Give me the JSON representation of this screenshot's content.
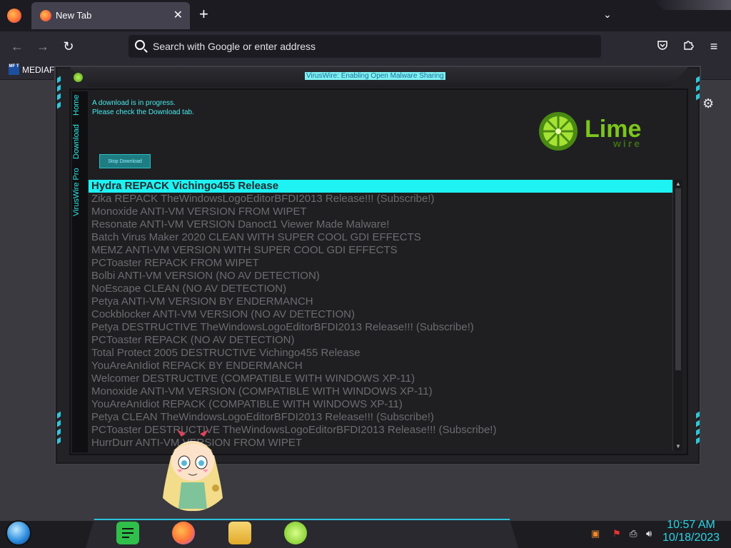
{
  "browser": {
    "tab_title": "New Tab",
    "tab_close": "✕",
    "new_tab": "+",
    "list_tabs": "⌄",
    "url_placeholder": "Search with Google or enter address",
    "bookmark": {
      "label": "MEDIAFI",
      "icon_text": "MF T"
    }
  },
  "app": {
    "title": "VirusWire: Enabling Open Malware Sharing",
    "side_tabs": [
      "Home",
      "Download",
      "VirusWire Pro"
    ],
    "message_line1": "A download is in progress.",
    "message_line2": "Please check the Download tab.",
    "action_button": "Stop Download",
    "logo_text_top": "Lime",
    "logo_text_bottom": "wire",
    "selected_index": 0,
    "items": [
      "Hydra REPACK Vichingo455 Release",
      "Zika REPACK TheWindowsLogoEditorBFDI2013 Release!!! (Subscribe!)",
      "Monoxide ANTI-VM VERSION FROM WIPET",
      "Resonate ANTI-VM VERSION Danoct1 Viewer Made Malware!",
      "Batch Virus Maker 2020 CLEAN WITH SUPER COOL GDI EFFECTS",
      "MEMZ ANTI-VM VERSION WITH SUPER COOL GDI EFFECTS",
      "PCToaster REPACK FROM WIPET",
      "Bolbi ANTI-VM VERSION (NO AV DETECTION)",
      "NoEscape CLEAN (NO AV DETECTION)",
      "Petya ANTI-VM VERSION BY ENDERMANCH",
      "Cockblocker ANTI-VM VERSION (NO AV DETECTION)",
      "Petya DESTRUCTIVE TheWindowsLogoEditorBFDI2013 Release!!! (Subscribe!)",
      "PCToaster REPACK (NO AV DETECTION)",
      "Total Protect 2005 DESTRUCTIVE Vichingo455 Release",
      "YouAreAnIdiot REPACK BY ENDERMANCH",
      "Welcomer DESTRUCTIVE (COMPATIBLE WITH WINDOWS XP-11)",
      "Monoxide ANTI-VM VERSION (COMPATIBLE WITH WINDOWS XP-11)",
      "YouAreAnIdiot REPACK (COMPATIBLE WITH WINDOWS XP-11)",
      "Petya CLEAN TheWindowsLogoEditorBFDI2013 Release!!! (Subscribe!)",
      "PCToaster DESTRUCTIVE TheWindowsLogoEditorBFDI2013 Release!!! (Subscribe!)",
      "HurrDurr ANTI-VM VERSION FROM WIPET"
    ]
  },
  "taskbar": {
    "time": "10:57 AM",
    "date": "10/18/2023"
  },
  "colors": {
    "accent_cyan": "#1ef2f2",
    "lime": "#7bc61c"
  }
}
